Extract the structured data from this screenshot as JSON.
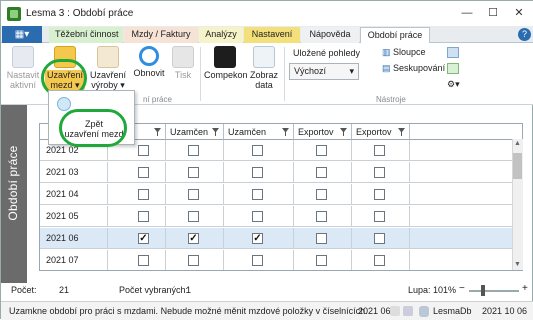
{
  "window": {
    "title": "Lesma 3 : Období práce",
    "minimize": "—",
    "maximize": "☐",
    "close": "✕"
  },
  "ribbon_tabs": [
    "Těžební činnost",
    "Mzdy / Faktury",
    "Analýzy",
    "Nastavení",
    "Nápověda",
    "Období práce"
  ],
  "ribbon": {
    "nastavit_line1": "Nastavit",
    "nastavit_line2": "aktivní",
    "uzavreni_line1": "Uzavření",
    "uzavreni_line2": "mezd",
    "uzavreni_vyroby_line1": "Uzavření",
    "uzavreni_vyroby_line2": "výroby",
    "obnovit": "Obnovit",
    "tisk": "Tisk",
    "compekon": "Compekon",
    "zobraz_line1": "Zobraz",
    "zobraz_line2": "data",
    "ulozene_pohledy": "Uložené pohledy",
    "vychozi": "Výchozí",
    "sloupce": "Sloupce",
    "seskupovani": "Seskupování",
    "group_prace": "ní práce",
    "group_nastroje": "Nástroje"
  },
  "popup": {
    "line1": "Zpět",
    "line2": "uzavření mezd"
  },
  "side_label": "Období práce",
  "grid": {
    "headers": [
      "",
      "ní",
      "Uzamčen",
      "Uzamčen",
      "Exportov",
      "Exportov"
    ],
    "rows": [
      {
        "period": "2021 02",
        "checks": [
          false,
          false,
          false,
          false,
          false
        ]
      },
      {
        "period": "2021 03",
        "checks": [
          false,
          false,
          false,
          false,
          false
        ]
      },
      {
        "period": "2021 04",
        "checks": [
          false,
          false,
          false,
          false,
          false
        ]
      },
      {
        "period": "2021 05",
        "checks": [
          false,
          false,
          false,
          false,
          false
        ]
      },
      {
        "period": "2021 06",
        "checks": [
          true,
          true,
          true,
          false,
          false
        ],
        "selected": true
      },
      {
        "period": "2021 07",
        "checks": [
          false,
          false,
          false,
          false,
          false
        ]
      }
    ]
  },
  "info": {
    "pocet_label": "Počet:",
    "pocet_value": "21",
    "vybranych_label": "Počet vybraných:",
    "vybranych_value": "1",
    "lupa_label": "Lupa: 101%",
    "lupa_minus": "−",
    "lupa_plus": "+",
    "zoom_percent": 101
  },
  "status": {
    "message": "Uzamkne období pro práci s mzdami. Nebude možné měnit mzdové položky v číselnících.",
    "period": "2021 06",
    "db": "LesmaDb",
    "date": "2021 10 06"
  },
  "colors": {
    "accent": "#2b6cb0",
    "highlight_ring": "#20a83a",
    "strip": "#6b6b6b",
    "selected_row": "#dbe9f7"
  }
}
